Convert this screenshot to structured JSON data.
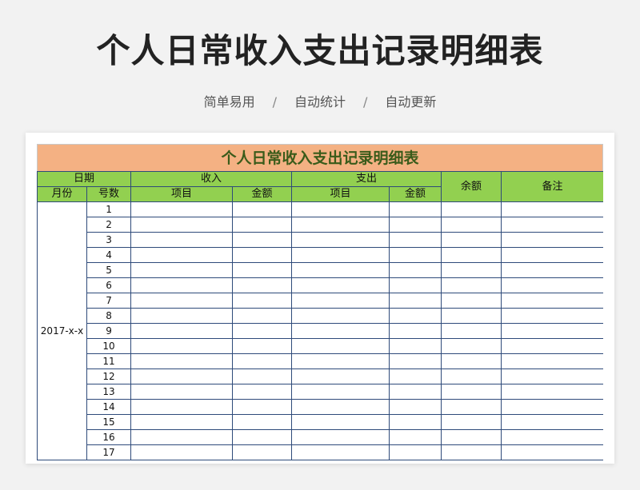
{
  "hero": {
    "title": "个人日常收入支出记录明细表",
    "tags": [
      "简单易用",
      "自动统计",
      "自动更新"
    ],
    "separator": "/"
  },
  "sheet": {
    "title": "个人日常收入支出记录明细表",
    "header": {
      "date": "日期",
      "income": "收入",
      "expense": "支出",
      "balance": "余额",
      "notes": "备注",
      "month": "月份",
      "number": "号数",
      "income_item": "项目",
      "income_amount": "金额",
      "expense_item": "项目",
      "expense_amount": "金额"
    },
    "month_value": "2017-x-x",
    "day_numbers": [
      "1",
      "2",
      "3",
      "4",
      "5",
      "6",
      "7",
      "8",
      "9",
      "10",
      "11",
      "12",
      "13",
      "14",
      "15",
      "16",
      "17"
    ]
  },
  "colors": {
    "title_band": "#f4b183",
    "header_green": "#92d050",
    "grid_border": "#2e4a7a",
    "title_text": "#3a5b1a"
  }
}
